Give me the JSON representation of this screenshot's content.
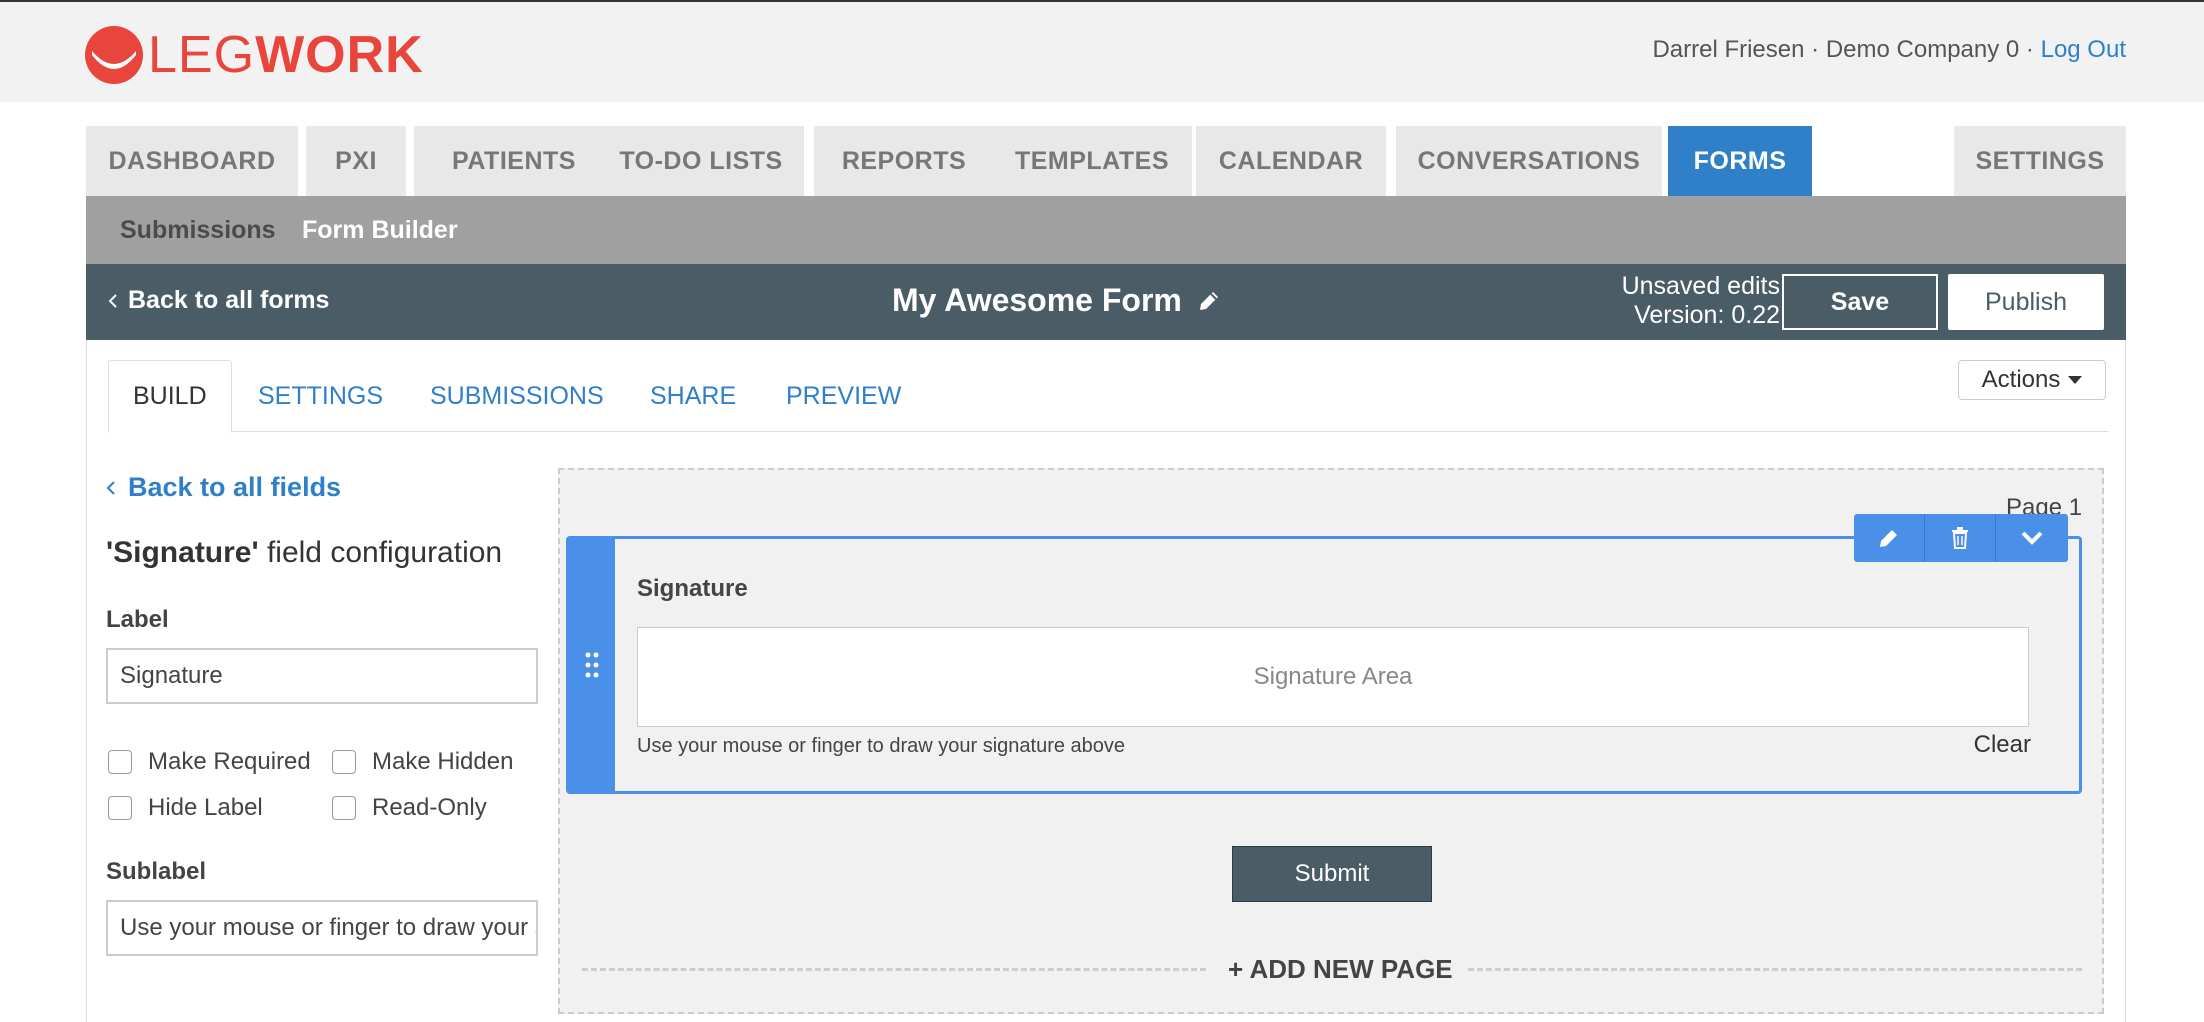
{
  "header": {
    "logo_text_a": "LEG",
    "logo_text_b": "WORK",
    "user_name": "Darrel Friesen",
    "separator": "·",
    "company": "Demo Company 0",
    "logout": "Log Out"
  },
  "main_tabs": [
    "DASHBOARD",
    "PXI",
    "PATIENTS",
    "TO-DO LISTS",
    "REPORTS",
    "TEMPLATES",
    "CALENDAR",
    "CONVERSATIONS",
    "FORMS",
    "SETTINGS"
  ],
  "active_main_tab": "FORMS",
  "sub_nav": {
    "submissions": "Submissions",
    "form_builder": "Form Builder"
  },
  "form_bar": {
    "back": "Back to all forms",
    "title": "My Awesome Form",
    "unsaved": "Unsaved edits",
    "version": "Version: 0.22",
    "save": "Save",
    "publish": "Publish"
  },
  "build_tabs": [
    "BUILD",
    "SETTINGS",
    "SUBMISSIONS",
    "SHARE",
    "PREVIEW"
  ],
  "actions": "Actions",
  "config": {
    "back": "Back to all fields",
    "title_bold": "'Signature'",
    "title_rest": " field configuration",
    "label_heading": "Label",
    "label_value": "Signature",
    "make_required": "Make Required",
    "make_hidden": "Make Hidden",
    "hide_label": "Hide Label",
    "read_only": "Read-Only",
    "sublabel_heading": "Sublabel",
    "sublabel_value": "Use your mouse or finger to draw your signature above"
  },
  "canvas": {
    "page": "Page 1",
    "field_title": "Signature",
    "sig_area": "Signature Area",
    "hint": "Use your mouse or finger to draw your signature above",
    "clear": "Clear",
    "submit": "Submit",
    "add_page": "+ ADD NEW PAGE"
  },
  "colors": {
    "brand": "#e8453c",
    "primary": "#2f7fc9",
    "dark_bar": "#4a5d66",
    "field_accent": "#4a8fe8"
  }
}
